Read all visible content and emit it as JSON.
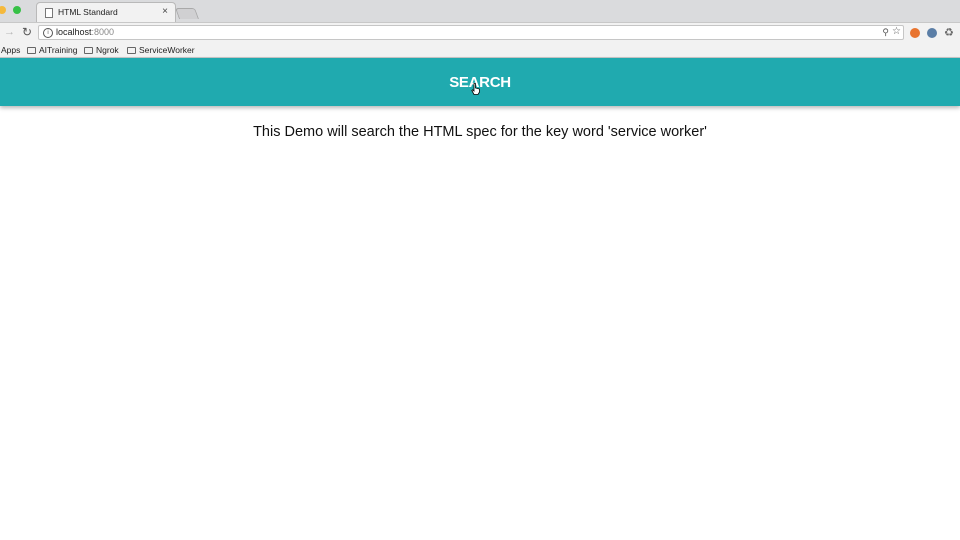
{
  "browser": {
    "tab_title": "HTML Standard",
    "url_host": "localhost",
    "url_port": ":8000",
    "bookmarks": [
      "Apps",
      "AITraining",
      "Ngrok",
      "ServiceWorker"
    ]
  },
  "page": {
    "search_button_label": "SEARCH",
    "message": "This Demo will search the HTML spec for the key word 'service worker'",
    "accent_color": "#20aaaf"
  },
  "icons": [
    "doc-icon",
    "close-icon",
    "forward-icon",
    "reload-icon",
    "info-icon",
    "zoom-icon",
    "star-icon",
    "folder-icon",
    "pointer-cursor-icon"
  ]
}
